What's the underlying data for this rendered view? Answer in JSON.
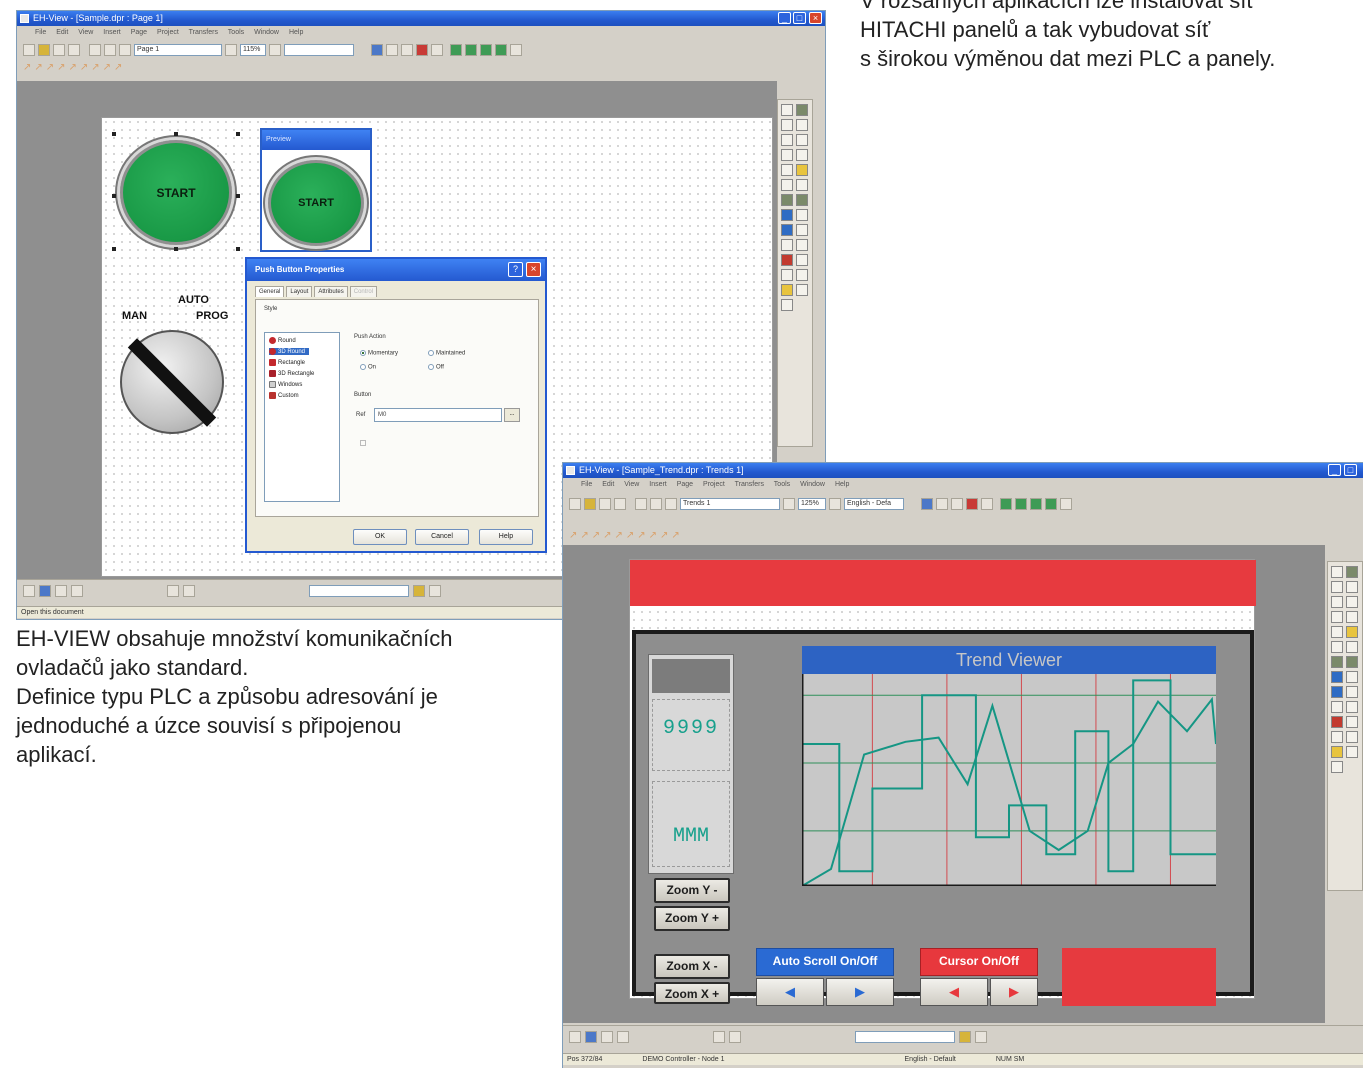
{
  "top_right_text": [
    "V rozsáhlých aplikacích lze instalovat síť",
    "HITACHI panelů a tak vybudovat síť",
    "s širokou výměnou dat mezi PLC a panely."
  ],
  "left_text": [
    "EH-VIEW obsahuje množství komunikačních",
    "ovladačů jako standard.",
    "Definice typu PLC a způsobu adresování je",
    "jednoduché a úzce souvisí s připojenou",
    "aplikací."
  ],
  "window1": {
    "title": "EH-View - [Sample.dpr : Page 1]",
    "menu": [
      "File",
      "Edit",
      "View",
      "Insert",
      "Page",
      "Project",
      "Transfers",
      "Tools",
      "Window",
      "Help"
    ],
    "page_combo": "Page 1",
    "zoom_combo": "115%",
    "canvas": {
      "start_button_label": "START",
      "preview_title": "Preview",
      "preview_button_label": "START",
      "selector_label_top": "AUTO",
      "selector_label_left": "MAN",
      "selector_label_right": "PROG"
    },
    "dialog": {
      "title": "Push Button Properties",
      "tabs": [
        "General",
        "Layout",
        "Attributes",
        "Control"
      ],
      "style_group": "Style",
      "styles": [
        "Round",
        "3D Round",
        "Rectangle",
        "3D Rectangle",
        "Windows",
        "Custom"
      ],
      "push_action_group": "Push Action",
      "push_actions": [
        "Momentary",
        "Maintained",
        "On",
        "Off"
      ],
      "button_group": "Button",
      "ref_label": "Ref",
      "ref_value": "M0",
      "ok": "OK",
      "cancel": "Cancel",
      "help": "Help"
    },
    "status": "Open this document"
  },
  "window2": {
    "title": "EH-View - [Sample_Trend.dpr : Trends 1]",
    "menu": [
      "File",
      "Edit",
      "View",
      "Insert",
      "Page",
      "Project",
      "Transfers",
      "Tools",
      "Window",
      "Help"
    ],
    "page_combo": "Trends 1",
    "zoom_combo": "125%",
    "lang_combo": "English - Defa",
    "trend": {
      "header": "Trend Viewer",
      "gauge_value_1": "9999",
      "gauge_value_2": "MMM",
      "zoom_y_minus": "Zoom Y -",
      "zoom_y_plus": "Zoom Y +",
      "zoom_x_minus": "Zoom X -",
      "zoom_x_plus": "Zoom X +",
      "auto_scroll": "Auto Scroll On/Off",
      "cursor": "Cursor On/Off",
      "prev_arrow": "◀",
      "next_arrow": "▶"
    },
    "status": [
      "Pos 372/84",
      "DEMO Controller - Node 1",
      "English - Default",
      "NUM  SM"
    ]
  },
  "colors": {
    "titlebar_blue": "#2459d0",
    "canvas_gray": "#8f8f8f",
    "start_green": "#199946",
    "banner_red": "#e73a3f",
    "trend_blue": "#2d63c3",
    "series_teal": "#159684",
    "grid_red": "#d24a4f",
    "grid_green": "#2f8f5a"
  }
}
